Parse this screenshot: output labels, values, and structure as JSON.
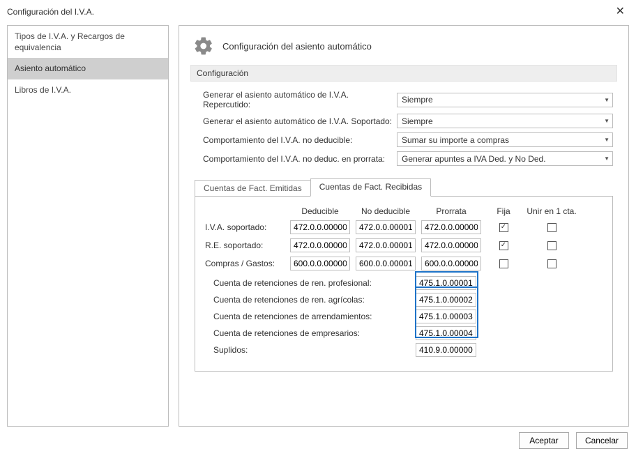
{
  "window": {
    "title": "Configuración del I.V.A."
  },
  "sidebar": {
    "items": [
      {
        "label": "Tipos de I.V.A. y Recargos de equivalencia",
        "selected": false
      },
      {
        "label": "Asiento automático",
        "selected": true
      },
      {
        "label": "Libros de I.V.A.",
        "selected": false
      }
    ]
  },
  "panel": {
    "title": "Configuración del asiento automático",
    "section_header": "Configuración"
  },
  "config": {
    "rows": [
      {
        "label": "Generar el asiento automático de I.V.A. Repercutido:",
        "value": "Siempre"
      },
      {
        "label": "Generar el asiento automático de I.V.A. Soportado:",
        "value": "Siempre"
      },
      {
        "label": "Comportamiento del I.V.A. no deducible:",
        "value": "Sumar su importe a compras"
      },
      {
        "label": "Comportamiento del I.V.A. no deduc. en prorrata:",
        "value": "Generar apuntes a IVA Ded. y No Ded."
      }
    ]
  },
  "tabs": {
    "emitidas": "Cuentas de Fact. Emitidas",
    "recibidas": "Cuentas de Fact. Recibidas"
  },
  "grid": {
    "headers": {
      "deducible": "Deducible",
      "no_deducible": "No deducible",
      "prorrata": "Prorrata",
      "fija": "Fija",
      "unir": "Unir en 1 cta."
    },
    "rows": [
      {
        "label": "I.V.A. soportado:",
        "deducible": "472.0.0.00000",
        "no_ded": "472.0.0.00001",
        "prorrata": "472.0.0.00000",
        "fija": true,
        "unir": false
      },
      {
        "label": "R.E. soportado:",
        "deducible": "472.0.0.00000",
        "no_ded": "472.0.0.00001",
        "prorrata": "472.0.0.00000",
        "fija": true,
        "unir": false
      },
      {
        "label": "Compras / Gastos:",
        "deducible": "600.0.0.00000",
        "no_ded": "600.0.0.00001",
        "prorrata": "600.0.0.00000",
        "fija": false,
        "unir": false
      }
    ]
  },
  "retenciones": [
    {
      "label": "Cuenta de retenciones de ren. profesional:",
      "value": "475.1.0.00001"
    },
    {
      "label": "Cuenta de retenciones de ren. agrícolas:",
      "value": "475.1.0.00002"
    },
    {
      "label": "Cuenta de retenciones de arrendamientos:",
      "value": "475.1.0.00003"
    },
    {
      "label": "Cuenta de retenciones de empresarios:",
      "value": "475.1.0.00004"
    }
  ],
  "suplidos": {
    "label": "Suplidos:",
    "value": "410.9.0.00000"
  },
  "footer": {
    "ok": "Aceptar",
    "cancel": "Cancelar"
  }
}
